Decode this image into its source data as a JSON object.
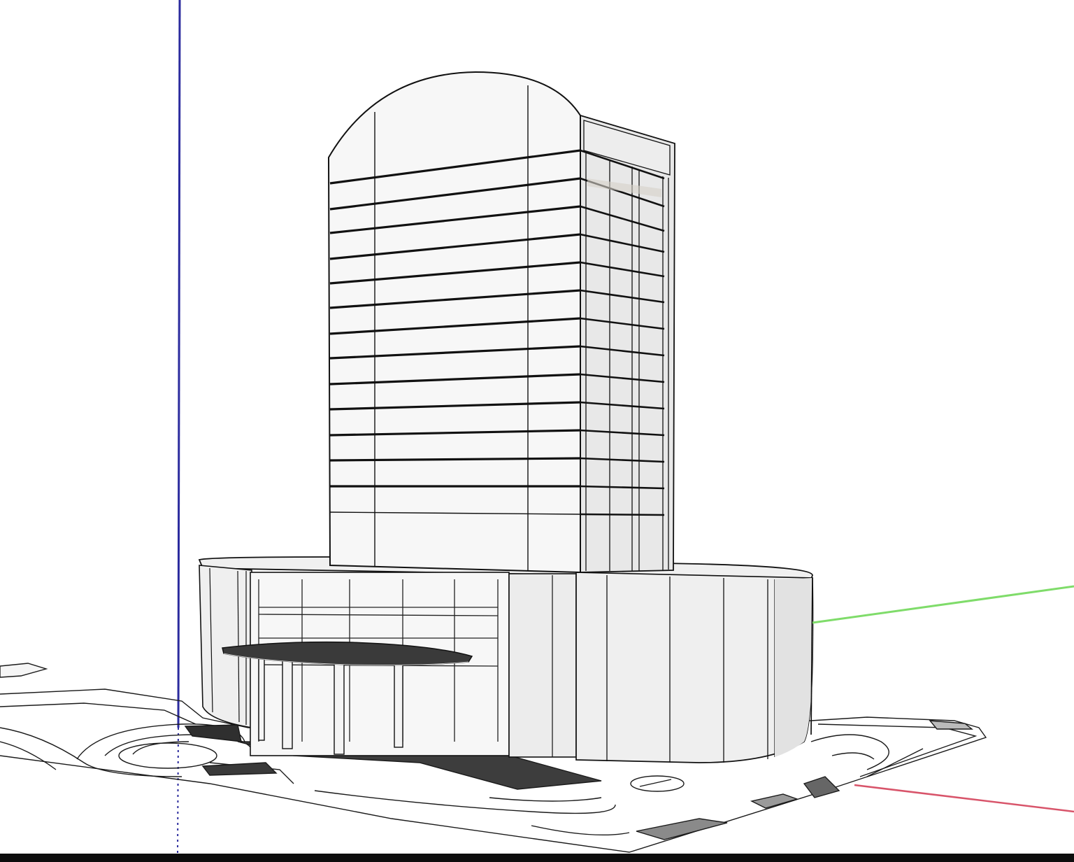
{
  "viewport": {
    "background": "#ffffff",
    "model": "building-model",
    "view": "perspective"
  },
  "axes": {
    "blue_axis_color": "#2b2b9e",
    "green_axis_color": "#7fdc6a",
    "red_axis_color": "#d8546a"
  },
  "model_colors": {
    "line": "#111111",
    "glass": "#f3f3f3",
    "side_face": "#e6e6e6",
    "canopy": "#3a3a3a",
    "pavement": "#555555"
  },
  "statusbar": {
    "background": "#0d0d0d"
  }
}
